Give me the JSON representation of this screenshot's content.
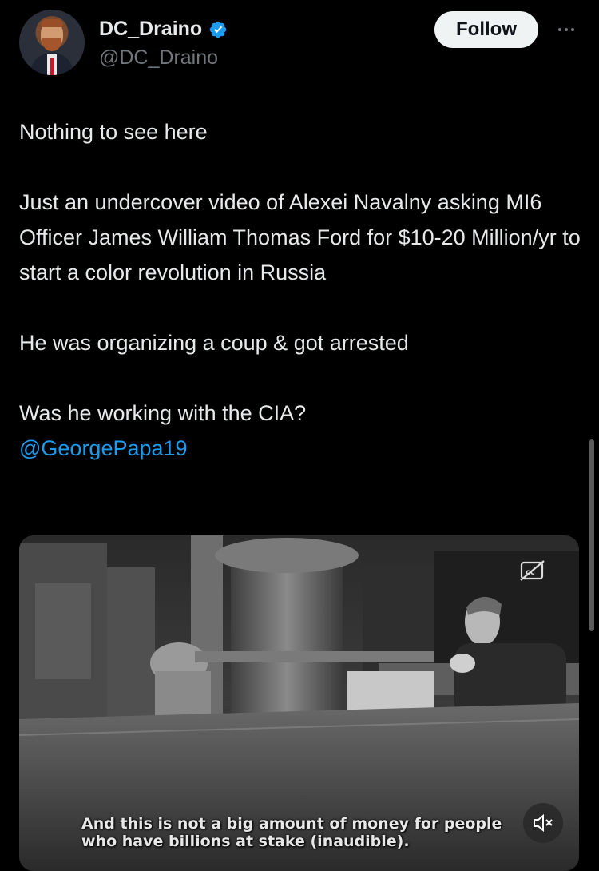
{
  "author": {
    "display_name": "DC_Draino",
    "handle": "@DC_Draino",
    "verified": true
  },
  "actions": {
    "follow_label": "Follow"
  },
  "tweet": {
    "line1": "Nothing to see here",
    "paragraph2": "Just an undercover video of Alexei Navalny asking MI6 Officer James William Thomas Ford for $10-20 Million/yr to start a color revolution in Russia",
    "line3": "He was organizing a coup & got arrested",
    "line4": "Was he working with the CIA?",
    "mention": "@GeorgePapa19"
  },
  "video": {
    "subtitle_line1": "And this is not a big amount of money for people",
    "subtitle_line2": "who have billions at stake (inaudible)."
  },
  "colors": {
    "background": "#000000",
    "text": "#e7e9ea",
    "secondary": "#71767b",
    "link": "#1d9bf0",
    "verified_badge": "#1d9bf0"
  },
  "icons": {
    "verified": "verified-badge-icon",
    "more": "more-options-icon",
    "captions": "captions-icon",
    "mute": "volume-muted-icon"
  }
}
